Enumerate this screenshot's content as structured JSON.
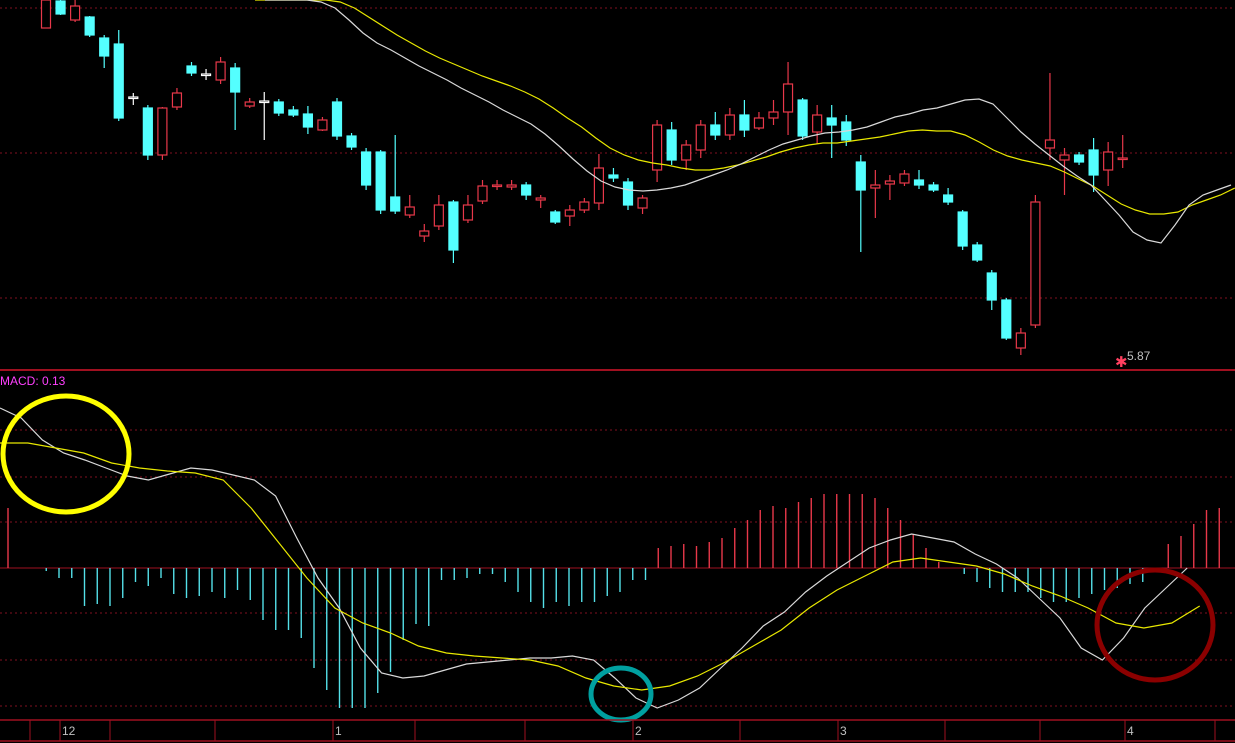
{
  "chart_data": [
    {
      "type": "candlestick",
      "panel": "price",
      "title": "",
      "grid": true,
      "colors": {
        "up": "#e8384a",
        "down": "#54ffff",
        "ma_short": "#d9d9d9",
        "ma_long": "#e8e800",
        "background": "#000000"
      },
      "candles": [
        {
          "o": 28,
          "h": 22,
          "l": 28,
          "c": 0,
          "color": "up"
        },
        {
          "o": 1,
          "h": 0,
          "l": 15,
          "c": 14,
          "color": "down"
        },
        {
          "o": 6,
          "h": 0,
          "l": 22,
          "c": 20,
          "color": "up"
        },
        {
          "o": 17,
          "h": 16,
          "l": 37,
          "c": 35,
          "color": "down"
        },
        {
          "o": 38,
          "h": 35,
          "l": 68,
          "c": 56,
          "color": "down"
        },
        {
          "o": 44,
          "h": 30,
          "l": 121,
          "c": 118,
          "color": "down"
        },
        {
          "o": 97,
          "h": 93,
          "l": 105,
          "c": 98,
          "color": "doji"
        },
        {
          "o": 108,
          "h": 105,
          "l": 160,
          "c": 155,
          "color": "down"
        },
        {
          "o": 155,
          "h": 107,
          "l": 160,
          "c": 108,
          "color": "up"
        },
        {
          "o": 107,
          "h": 88,
          "l": 110,
          "c": 93,
          "color": "up"
        },
        {
          "o": 66,
          "h": 62,
          "l": 76,
          "c": 73,
          "color": "down"
        },
        {
          "o": 75,
          "h": 69,
          "l": 80,
          "c": 74,
          "color": "doji"
        },
        {
          "o": 80,
          "h": 57,
          "l": 84,
          "c": 62,
          "color": "up"
        },
        {
          "o": 68,
          "h": 63,
          "l": 130,
          "c": 92,
          "color": "down"
        },
        {
          "o": 106,
          "h": 98,
          "l": 108,
          "c": 102,
          "color": "up"
        },
        {
          "o": 101,
          "h": 92,
          "l": 140,
          "c": 101,
          "color": "doji_white"
        },
        {
          "o": 102,
          "h": 99,
          "l": 116,
          "c": 113,
          "color": "down"
        },
        {
          "o": 110,
          "h": 106,
          "l": 117,
          "c": 115,
          "color": "down"
        },
        {
          "o": 114,
          "h": 106,
          "l": 134,
          "c": 127,
          "color": "down"
        },
        {
          "o": 130,
          "h": 117,
          "l": 131,
          "c": 120,
          "color": "up"
        },
        {
          "o": 102,
          "h": 98,
          "l": 140,
          "c": 136,
          "color": "down"
        },
        {
          "o": 136,
          "h": 133,
          "l": 150,
          "c": 147,
          "color": "down"
        },
        {
          "o": 152,
          "h": 148,
          "l": 190,
          "c": 185,
          "color": "down"
        },
        {
          "o": 152,
          "h": 150,
          "l": 214,
          "c": 210,
          "color": "down"
        },
        {
          "o": 197,
          "h": 135,
          "l": 214,
          "c": 211,
          "color": "down"
        },
        {
          "o": 207,
          "h": 195,
          "l": 218,
          "c": 215,
          "color": "up"
        },
        {
          "o": 236,
          "h": 224,
          "l": 242,
          "c": 231,
          "color": "up"
        },
        {
          "o": 226,
          "h": 195,
          "l": 230,
          "c": 205,
          "color": "up"
        },
        {
          "o": 202,
          "h": 200,
          "l": 263,
          "c": 250,
          "color": "down"
        },
        {
          "o": 220,
          "h": 195,
          "l": 223,
          "c": 205,
          "color": "up"
        },
        {
          "o": 201,
          "h": 180,
          "l": 204,
          "c": 186,
          "color": "up"
        },
        {
          "o": 185,
          "h": 180,
          "l": 190,
          "c": 185,
          "color": "doji_up"
        },
        {
          "o": 185,
          "h": 180,
          "l": 190,
          "c": 187,
          "color": "doji_up"
        },
        {
          "o": 185,
          "h": 182,
          "l": 200,
          "c": 195,
          "color": "down"
        },
        {
          "o": 198,
          "h": 195,
          "l": 208,
          "c": 200,
          "color": "doji_up"
        },
        {
          "o": 212,
          "h": 210,
          "l": 224,
          "c": 222,
          "color": "down"
        },
        {
          "o": 216,
          "h": 205,
          "l": 226,
          "c": 210,
          "color": "up"
        },
        {
          "o": 210,
          "h": 198,
          "l": 213,
          "c": 202,
          "color": "up"
        },
        {
          "o": 203,
          "h": 154,
          "l": 210,
          "c": 168,
          "color": "up"
        },
        {
          "o": 175,
          "h": 168,
          "l": 182,
          "c": 178,
          "color": "down"
        },
        {
          "o": 182,
          "h": 178,
          "l": 210,
          "c": 205,
          "color": "down"
        },
        {
          "o": 208,
          "h": 195,
          "l": 214,
          "c": 198,
          "color": "up"
        },
        {
          "o": 170,
          "h": 120,
          "l": 182,
          "c": 125,
          "color": "up"
        },
        {
          "o": 130,
          "h": 122,
          "l": 165,
          "c": 160,
          "color": "down"
        },
        {
          "o": 160,
          "h": 140,
          "l": 170,
          "c": 145,
          "color": "up"
        },
        {
          "o": 150,
          "h": 120,
          "l": 158,
          "c": 125,
          "color": "up"
        },
        {
          "o": 125,
          "h": 112,
          "l": 140,
          "c": 135,
          "color": "down"
        },
        {
          "o": 135,
          "h": 108,
          "l": 140,
          "c": 115,
          "color": "up"
        },
        {
          "o": 115,
          "h": 100,
          "l": 137,
          "c": 130,
          "color": "down"
        },
        {
          "o": 128,
          "h": 112,
          "l": 130,
          "c": 118,
          "color": "up"
        },
        {
          "o": 118,
          "h": 100,
          "l": 125,
          "c": 112,
          "color": "doji_up"
        },
        {
          "o": 112,
          "h": 62,
          "l": 135,
          "c": 84,
          "color": "up"
        },
        {
          "o": 100,
          "h": 98,
          "l": 140,
          "c": 136,
          "color": "down"
        },
        {
          "o": 132,
          "h": 105,
          "l": 144,
          "c": 115,
          "color": "up"
        },
        {
          "o": 118,
          "h": 105,
          "l": 158,
          "c": 125,
          "color": "down"
        },
        {
          "o": 122,
          "h": 115,
          "l": 146,
          "c": 140,
          "color": "down"
        },
        {
          "o": 162,
          "h": 155,
          "l": 252,
          "c": 190,
          "color": "down"
        },
        {
          "o": 188,
          "h": 170,
          "l": 218,
          "c": 185,
          "color": "up"
        },
        {
          "o": 181,
          "h": 175,
          "l": 200,
          "c": 184,
          "color": "up"
        },
        {
          "o": 174,
          "h": 170,
          "l": 186,
          "c": 183,
          "color": "up"
        },
        {
          "o": 180,
          "h": 170,
          "l": 189,
          "c": 185,
          "color": "down"
        },
        {
          "o": 185,
          "h": 182,
          "l": 192,
          "c": 190,
          "color": "down"
        },
        {
          "o": 195,
          "h": 188,
          "l": 205,
          "c": 202,
          "color": "down"
        },
        {
          "o": 212,
          "h": 210,
          "l": 250,
          "c": 246,
          "color": "down"
        },
        {
          "o": 245,
          "h": 242,
          "l": 262,
          "c": 260,
          "color": "down"
        },
        {
          "o": 273,
          "h": 270,
          "l": 310,
          "c": 300,
          "color": "down"
        },
        {
          "o": 300,
          "h": 298,
          "l": 340,
          "c": 338,
          "color": "down"
        },
        {
          "o": 348,
          "h": 328,
          "l": 355,
          "c": 333,
          "color": "up"
        },
        {
          "o": 325,
          "h": 195,
          "l": 328,
          "c": 202,
          "color": "up"
        },
        {
          "o": 148,
          "h": 73,
          "l": 160,
          "c": 140,
          "color": "up"
        },
        {
          "o": 160,
          "h": 148,
          "l": 195,
          "c": 155,
          "color": "up"
        },
        {
          "o": 162,
          "h": 152,
          "l": 165,
          "c": 155,
          "color": "down"
        },
        {
          "o": 150,
          "h": 138,
          "l": 192,
          "c": 175,
          "color": "down"
        },
        {
          "o": 170,
          "h": 142,
          "l": 186,
          "c": 152,
          "color": "up"
        },
        {
          "o": 158,
          "h": 135,
          "l": 168,
          "c": 158,
          "color": "up"
        }
      ],
      "ma_short": [
        0,
        0,
        0,
        0,
        2,
        8,
        20,
        33,
        43,
        50,
        58,
        66,
        73,
        80,
        88,
        95,
        102,
        110,
        117,
        124,
        134,
        146,
        159,
        171,
        181,
        187,
        190,
        191,
        190,
        188,
        185,
        180,
        175,
        170,
        164,
        157,
        150,
        144,
        140,
        136,
        133,
        132,
        130,
        127,
        122,
        117,
        114,
        110,
        108,
        104,
        100,
        99,
        104,
        118,
        132,
        144,
        155,
        166,
        176,
        185,
        200,
        215,
        232,
        240,
        243,
        225,
        205,
        195,
        190,
        185
      ],
      "ma_long": [
        0,
        0,
        0,
        0,
        0,
        0,
        2,
        8,
        17,
        26,
        35,
        43,
        51,
        58,
        64,
        70,
        76,
        81,
        86,
        92,
        99,
        108,
        118,
        127,
        138,
        148,
        155,
        160,
        163,
        165,
        168,
        170,
        170,
        168,
        165,
        161,
        157,
        152,
        148,
        145,
        143,
        143,
        141,
        139,
        137,
        134,
        131,
        130,
        131,
        131,
        135,
        142,
        150,
        156,
        160,
        163,
        166,
        172,
        179,
        186,
        195,
        204,
        210,
        214,
        214,
        212,
        205,
        200,
        195,
        188
      ],
      "low_label": "5.87",
      "low_marker": "✱"
    },
    {
      "type": "macd",
      "panel": "indicator",
      "title": "MACD: 0.13",
      "grid": true,
      "x_tick_labels": [
        "12",
        "1",
        "2",
        "3",
        "4"
      ],
      "histogram": [
        60,
        0,
        0,
        -3,
        -10,
        -10,
        -38,
        -36,
        -38,
        -30,
        -14,
        -18,
        -10,
        -26,
        -30,
        -28,
        -24,
        -30,
        -22,
        -32,
        -52,
        -62,
        -62,
        -70,
        -100,
        -122,
        -140,
        -140,
        -140,
        -125,
        -104,
        -72,
        -56,
        -58,
        -12,
        -12,
        -10,
        -6,
        -6,
        -14,
        -24,
        -34,
        -40,
        -34,
        -38,
        -34,
        -34,
        -28,
        -24,
        -12,
        -12,
        20,
        22,
        24,
        22,
        26,
        30,
        40,
        48,
        58,
        62,
        60,
        66,
        70,
        74,
        74,
        74,
        74,
        70,
        60,
        48,
        34,
        20,
        6,
        0,
        -6,
        -14,
        -20,
        -24,
        -24,
        -24,
        -30,
        -34,
        -34,
        -30,
        -26,
        -22,
        -20,
        -16,
        -14,
        -4,
        24,
        32,
        44,
        58,
        60
      ],
      "macd_line": [
        160,
        150,
        128,
        115,
        108,
        100,
        92,
        88,
        94,
        100,
        98,
        93,
        88,
        72,
        30,
        -10,
        -40,
        -80,
        -105,
        -110,
        -108,
        -102,
        -96,
        -94,
        -92,
        -90,
        -90,
        -88,
        -92,
        -110,
        -130,
        -140,
        -132,
        -120,
        -100,
        -80,
        -58,
        -44,
        -24,
        -8,
        6,
        20,
        28,
        34,
        30,
        26,
        14,
        4,
        -10,
        -30,
        -50,
        -80,
        -92,
        -70,
        -40,
        -20,
        0
      ],
      "signal_line": [
        125,
        125,
        120,
        115,
        105,
        100,
        97,
        95,
        88,
        60,
        25,
        -10,
        -40,
        -55,
        -65,
        -78,
        -85,
        -88,
        -90,
        -92,
        -98,
        -110,
        -118,
        -122,
        -118,
        -108,
        -94,
        -78,
        -62,
        -40,
        -22,
        -8,
        6,
        10,
        6,
        2,
        -6,
        -18,
        -28,
        -40,
        -55,
        -60,
        -55,
        -38
      ]
    }
  ],
  "annotations": {
    "yellow_circle": "#ffff00",
    "teal_circle": "#00a0a0",
    "red_circle": "#8b0000"
  }
}
